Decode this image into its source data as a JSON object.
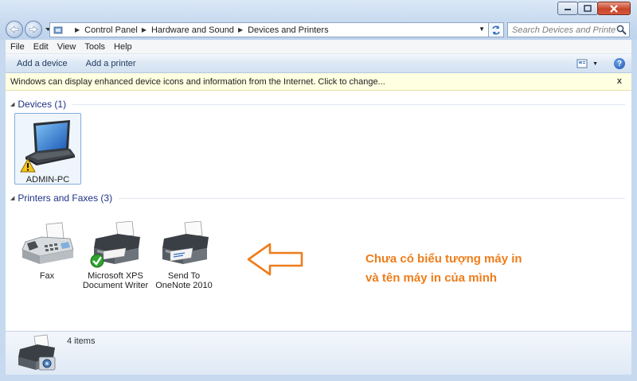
{
  "window": {
    "controls": [
      "minimize-icon",
      "maximize-icon",
      "close-icon"
    ]
  },
  "address": {
    "crumbs": [
      "Control Panel",
      "Hardware and Sound",
      "Devices and Printers"
    ]
  },
  "search": {
    "placeholder": "Search Devices and Printers"
  },
  "menu": [
    "File",
    "Edit",
    "View",
    "Tools",
    "Help"
  ],
  "commands": {
    "add_device": "Add a device",
    "add_printer": "Add a printer",
    "help": "?"
  },
  "infobar": {
    "text": "Windows can display enhanced device icons and information from the Internet. Click to change...",
    "close": "x"
  },
  "groups": {
    "devices": {
      "title": "Devices (1)",
      "items": [
        {
          "label": "ADMIN-PC",
          "icon": "laptop-warning-icon"
        }
      ]
    },
    "printers": {
      "title": "Printers and Faxes (3)",
      "items": [
        {
          "line1": "Fax",
          "line2": "",
          "icon": "fax-icon"
        },
        {
          "line1": "Microsoft XPS",
          "line2": "Document Writer",
          "icon": "printer-default-icon"
        },
        {
          "line1": "Send To",
          "line2": "OneNote 2010",
          "icon": "printer-icon"
        }
      ]
    }
  },
  "annotation": {
    "line1": "Chưa có biểu tượng máy in",
    "line2": "và tên máy in của mình",
    "color": "#ee7d1b"
  },
  "details": {
    "count": "4 items"
  }
}
